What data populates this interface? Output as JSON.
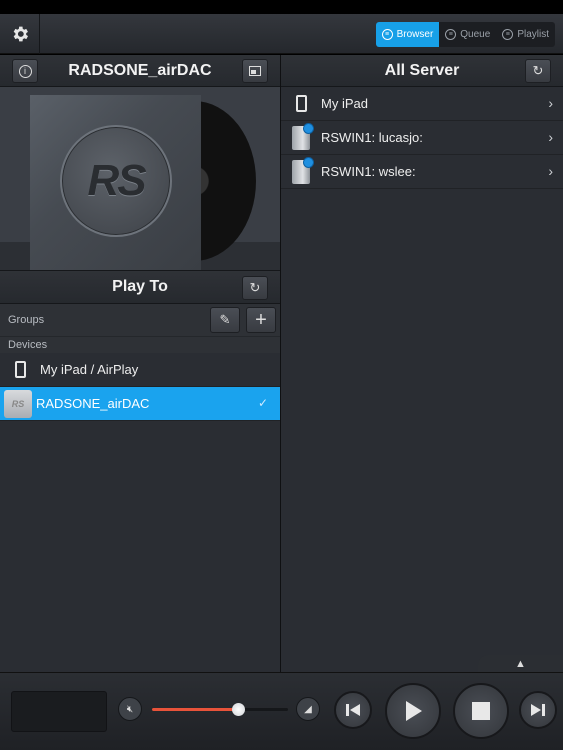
{
  "topbar": {
    "tabs": [
      {
        "label": "Browser",
        "active": true
      },
      {
        "label": "Queue",
        "active": false
      },
      {
        "label": "Playlist",
        "active": false
      }
    ]
  },
  "left_panel": {
    "title": "RADSONE_airDAC",
    "album_logo": "RS",
    "play_to": {
      "title": "Play To",
      "groups_label": "Groups",
      "devices_label": "Devices",
      "devices": [
        {
          "name": "My iPad / AirPlay",
          "icon": "phone-icon",
          "selected": false
        },
        {
          "name": "RADSONE_airDAC",
          "icon": "device-thumbnail",
          "thumb_text": "RS",
          "selected": true
        }
      ]
    }
  },
  "right_panel": {
    "title": "All Server",
    "servers": [
      {
        "name": "My iPad",
        "icon": "phone-icon"
      },
      {
        "name": "RSWIN1: lucasjo:",
        "icon": "server-icon"
      },
      {
        "name": "RSWIN1: wslee:",
        "icon": "server-icon"
      }
    ]
  },
  "player": {
    "volume_fraction": 0.63,
    "accent_color": "#e8533a",
    "selection_color": "#1aa3ee"
  }
}
